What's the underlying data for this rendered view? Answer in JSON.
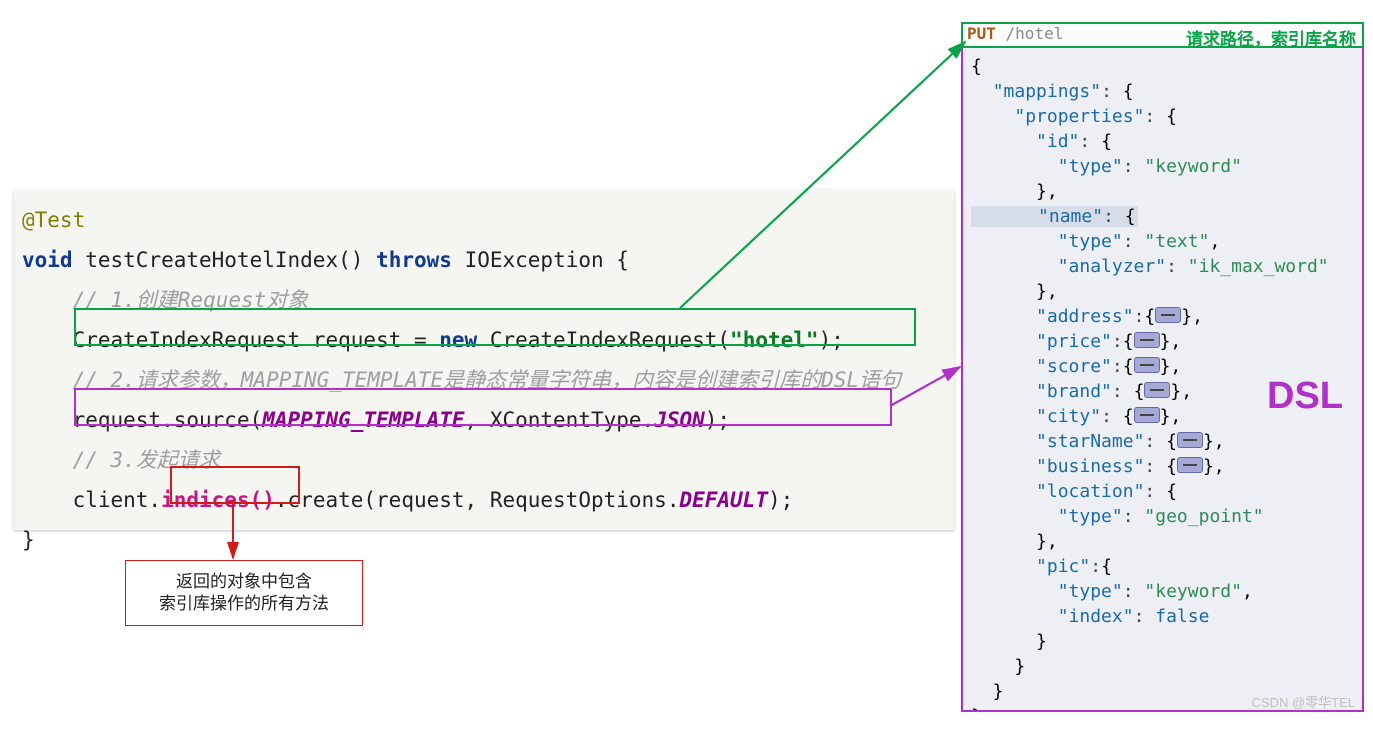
{
  "left": {
    "annotation": "@Test",
    "voidKw": "void",
    "methodName": "testCreateHotelIndex()",
    "throwsKw": "throws",
    "exc": "IOException {",
    "c1": "// 1.创建Request对象",
    "l1_a": "CreateIndexRequest request = ",
    "l1_new": "new",
    "l1_b": " CreateIndexRequest(",
    "l1_str": "\"hotel\"",
    "l1_c": ");",
    "c2": "// 2.请求参数，MAPPING_TEMPLATE是静态常量字符串，内容是创建索引库的DSL语句",
    "l2_a": "request.source(",
    "l2_tmpl": "MAPPING_TEMPLATE",
    "l2_b": ", XContentType.",
    "l2_json": "JSON",
    "l2_c": ");",
    "c3": "// 3.发起请求",
    "l3_a": "client.",
    "l3_idx": "indices()",
    "l3_b": ".create(request, RequestOptions.",
    "l3_def": "DEFAULT",
    "l3_c": ");",
    "close": "}",
    "annotation_box_l1": "返回的对象中包含",
    "annotation_box_l2": "索引库操作的所有方法"
  },
  "right": {
    "method": "PUT",
    "path": " /hotel",
    "header_label": "请求路径，索引库名称",
    "dsl_label": "DSL",
    "json_lines": [
      "{",
      "  \"mappings\": {",
      "    \"properties\": {",
      "      \"id\": {",
      "        \"type\": \"keyword\"",
      "      },",
      "      \"name\": {",
      "        \"type\": \"text\",",
      "        \"analyzer\": \"ik_max_word\"",
      "      },",
      "      \"address\":{◊},",
      "      \"price\":{◊},",
      "      \"score\":{◊},",
      "      \"brand\": {◊},",
      "      \"city\": {◊},",
      "      \"starName\": {◊},",
      "      \"business\": {◊},",
      "      \"location\": {",
      "        \"type\": \"geo_point\"",
      "      },",
      "      \"pic\":{",
      "        \"type\": \"keyword\",",
      "        \"index\": false",
      "      }",
      "    }",
      "  }",
      "}"
    ]
  },
  "watermark": "CSDN @零华TEL"
}
